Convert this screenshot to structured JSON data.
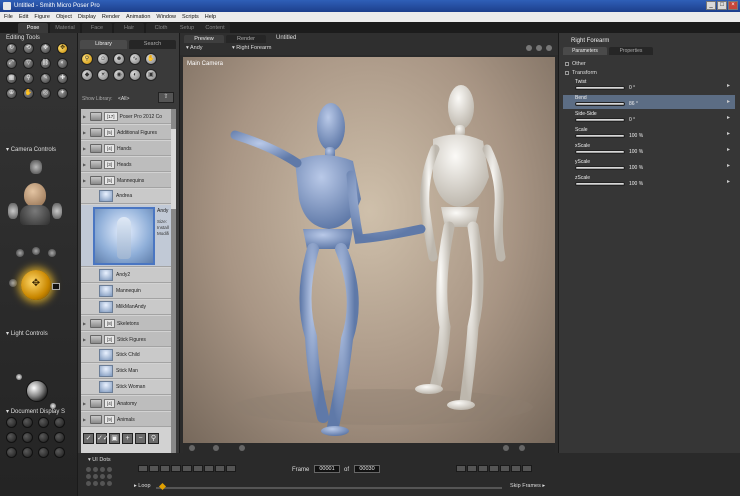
{
  "window": {
    "title": "Untitled - Smith Micro Poser Pro",
    "controls": [
      "_",
      "□",
      "×"
    ]
  },
  "menu": [
    "File",
    "Edit",
    "Figure",
    "Object",
    "Display",
    "Render",
    "Animation",
    "Window",
    "Scripts",
    "Help"
  ],
  "rooms": [
    {
      "label": "Pose",
      "active": true
    },
    {
      "label": "Material",
      "active": false
    },
    {
      "label": "Face",
      "active": false
    },
    {
      "label": "Hair",
      "active": false
    },
    {
      "label": "Cloth",
      "active": false
    },
    {
      "label": "Setup",
      "active": false
    },
    {
      "label": "Content",
      "active": false
    }
  ],
  "editing_tools": {
    "title": "Editing Tools",
    "tools": [
      "rotate-icon",
      "twist-icon",
      "translate-icon",
      "translate-in-out-icon",
      "scale-icon",
      "taper-icon",
      "chain-break-icon",
      "color-icon",
      "grouping-icon",
      "view-magnifier-icon",
      "morphing-tool-icon",
      "direct-manipulation-icon",
      "zoom-icon",
      "grab-icon",
      "rotate-world-icon",
      "direct-edit-icon"
    ],
    "active_index": 3
  },
  "camera_controls": {
    "title": "Camera Controls"
  },
  "light_controls": {
    "title": "Light Controls"
  },
  "document_display": {
    "title": "Document Display S"
  },
  "library": {
    "tabs": [
      "Library",
      "Search"
    ],
    "show_library_label": "Show Library:",
    "show_library_value": "<All>",
    "items": [
      {
        "kind": "folder",
        "badge": "[17]",
        "label": "Poser Pro 2012 Co"
      },
      {
        "kind": "folder",
        "badge": "[5]",
        "label": "Additional Figures"
      },
      {
        "kind": "folder",
        "badge": "[4]",
        "label": "Hands"
      },
      {
        "kind": "folder",
        "badge": "[3]",
        "label": "Heads"
      },
      {
        "kind": "folder",
        "badge": "[5]",
        "label": "Mannequins"
      },
      {
        "kind": "item",
        "label": "Andrea"
      },
      {
        "kind": "bigitem",
        "label": "Andy",
        "desc": [
          "Size:",
          "Install",
          "Modifi"
        ]
      },
      {
        "kind": "item",
        "label": "Andy2"
      },
      {
        "kind": "item",
        "label": "Mannequin"
      },
      {
        "kind": "item",
        "label": "MilkManAndy"
      },
      {
        "kind": "folder",
        "badge": "[8]",
        "label": "Skeletons"
      },
      {
        "kind": "folder",
        "badge": "[3]",
        "label": "Stick Figures"
      },
      {
        "kind": "item",
        "label": "Stick Child"
      },
      {
        "kind": "item",
        "label": "Stick Man"
      },
      {
        "kind": "item",
        "label": "Stick Woman"
      },
      {
        "kind": "folder",
        "badge": "[4]",
        "label": "Anatomy"
      },
      {
        "kind": "folder",
        "badge": "[9]",
        "label": "Animals"
      }
    ],
    "bottom_buttons": [
      "✓",
      "✓✓",
      "▣",
      "+",
      "−",
      "⚲"
    ]
  },
  "viewport": {
    "tabs": [
      {
        "label": "Preview",
        "active": true
      },
      {
        "label": "Render",
        "active": false
      }
    ],
    "document_title": "Untitled",
    "figure_selector": "▾ Andy",
    "part_selector": "▾ Right Forearm",
    "camera_label": "Main Camera"
  },
  "parameters": {
    "title": "Right Forearm",
    "tabs": [
      {
        "label": "Parameters",
        "active": true
      },
      {
        "label": "Properties",
        "active": false
      }
    ],
    "groups": [
      "Other",
      "Transform"
    ],
    "params": [
      {
        "name": "Twist",
        "value": "0 °",
        "selected": false
      },
      {
        "name": "Bend",
        "value": "86 °",
        "selected": true
      },
      {
        "name": "Side-Side",
        "value": "0 °",
        "selected": false
      },
      {
        "name": "Scale",
        "value": "100 %",
        "selected": false
      },
      {
        "name": "xScale",
        "value": "100 %",
        "selected": false
      },
      {
        "name": "yScale",
        "value": "100 %",
        "selected": false
      },
      {
        "name": "zScale",
        "value": "100 %",
        "selected": false
      }
    ]
  },
  "timeline": {
    "ui_dots_label": "UI Dots",
    "frame_label": "Frame",
    "current_frame": "00001",
    "of_label": "of",
    "total_frames": "00030",
    "loop_label": "Loop",
    "skip_frames_label": "Skip Frames"
  }
}
